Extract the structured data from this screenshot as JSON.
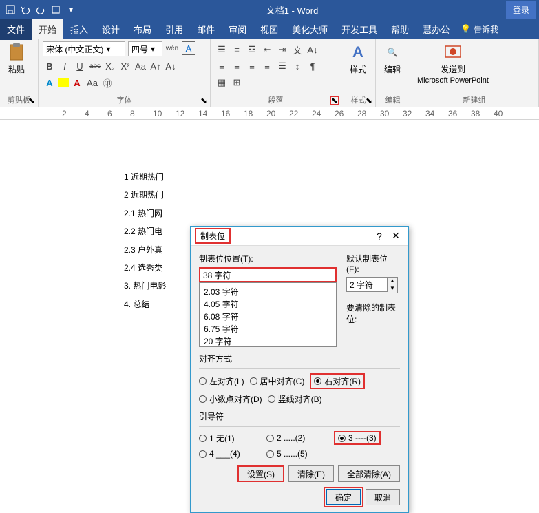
{
  "title": "文档1 - Word",
  "login": "登录",
  "menu": {
    "file": "文件",
    "home": "开始",
    "insert": "插入",
    "design": "设计",
    "layout": "布局",
    "references": "引用",
    "mailings": "邮件",
    "review": "审阅",
    "view": "视图",
    "beautify": "美化大师",
    "developer": "开发工具",
    "help": "帮助",
    "huiban": "慧办公",
    "tellme": "告诉我"
  },
  "ribbon": {
    "clipboard": {
      "label": "剪贴板",
      "paste": "粘贴"
    },
    "font": {
      "label": "字体",
      "family": "宋体 (中文正文)",
      "size": "四号",
      "wen": "wén",
      "bold": "B",
      "italic": "I",
      "underline": "U",
      "strike": "abc",
      "sub": "X₂",
      "sup": "X²",
      "aa": "Aa",
      "clear": "A"
    },
    "paragraph": {
      "label": "段落"
    },
    "styles": {
      "label": "样式",
      "btn": "样式"
    },
    "editing": {
      "label": "编辑",
      "btn": "编辑"
    },
    "newgroup": {
      "label": "新建组",
      "send": "发送到",
      "ppt": "Microsoft PowerPoint"
    }
  },
  "ruler_marks": [
    "2",
    "4",
    "6",
    "8",
    "10",
    "12",
    "14",
    "16",
    "18",
    "20",
    "22",
    "24",
    "26",
    "28",
    "30",
    "32",
    "34",
    "36",
    "38",
    "40"
  ],
  "doc_lines": [
    "1 近期热门",
    "2 近期热门",
    "2.1 热门网",
    "2.2 热门电",
    "2.3 户外真",
    "2.4 选秀类",
    "3. 热门电影",
    "4. 总结"
  ],
  "dialog": {
    "title": "制表位",
    "pos_label": "制表位位置(T):",
    "pos_value": "38 字符",
    "default_label": "默认制表位(F):",
    "default_value": "2 字符",
    "clear_label": "要清除的制表位:",
    "list": [
      "2.03 字符",
      "4.05 字符",
      "6.08 字符",
      "6.75 字符",
      "20 字符"
    ],
    "align_label": "对齐方式",
    "align": {
      "left": "左对齐(L)",
      "center": "居中对齐(C)",
      "right": "右对齐(R)",
      "decimal": "小数点对齐(D)",
      "bar": "竖线对齐(B)"
    },
    "leader_label": "引导符",
    "leader": {
      "l1": "1 无(1)",
      "l2": "2 .....(2)",
      "l3": "3 ----(3)",
      "l4": "4 ___(4)",
      "l5": "5 ......(5)"
    },
    "set": "设置(S)",
    "clear": "清除(E)",
    "clear_all": "全部清除(A)",
    "ok": "确定",
    "cancel": "取消"
  }
}
